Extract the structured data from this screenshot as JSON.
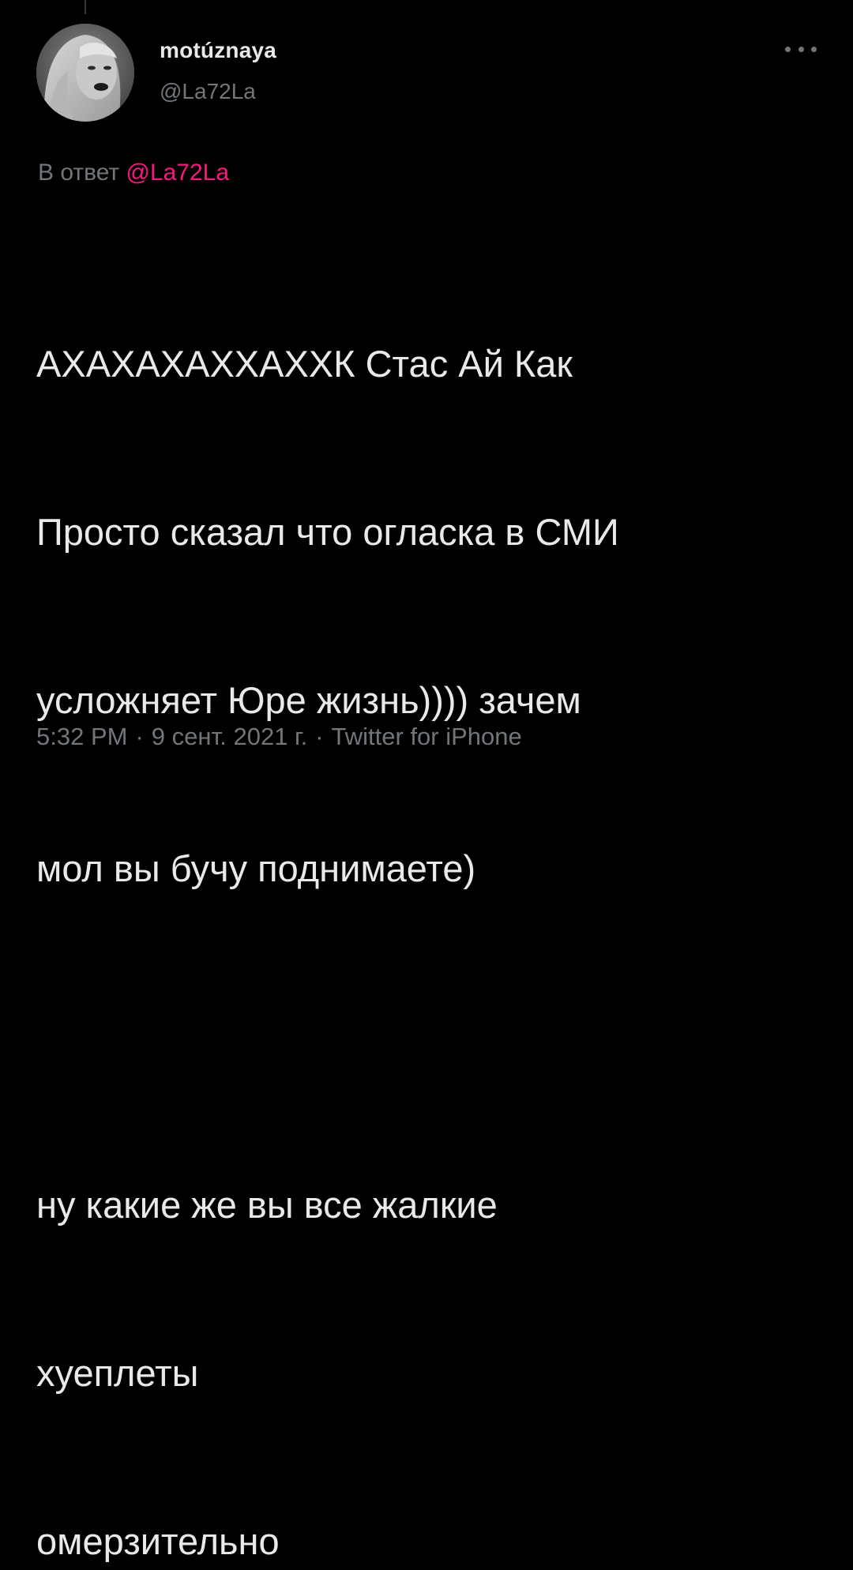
{
  "tweet": {
    "author": {
      "display_name": "motúznaya",
      "handle": "@La72La"
    },
    "reply_context": {
      "prefix": "В ответ",
      "mention": "@La72La"
    },
    "text_lines_block1": [
      "АХАХАХАХХАХХК Стас Ай Как",
      "Просто сказал что огласка в СМИ",
      "усложняет Юре жизнь)))) зачем",
      "мол вы бучу поднимаете)"
    ],
    "text_lines_block2": [
      "ну какие же вы все жалкие",
      "хуеплеты",
      "омерзительно"
    ],
    "meta": {
      "time": "5:32 PM",
      "separator": "·",
      "date": "9 сент. 2021 г.",
      "source": "Twitter for iPhone"
    }
  },
  "colors": {
    "background": "#000000",
    "text_primary": "#e7e9ea",
    "text_secondary": "#71767b",
    "mention": "#f91880"
  }
}
